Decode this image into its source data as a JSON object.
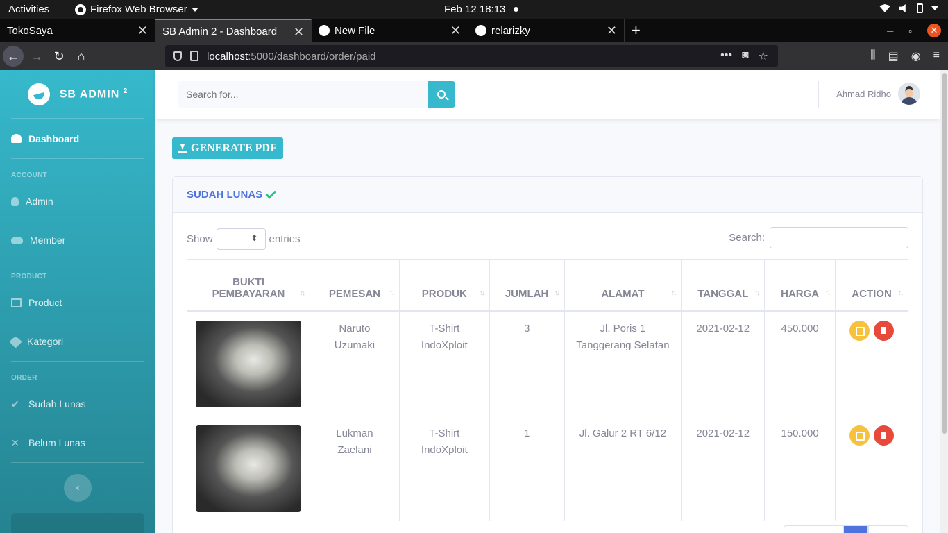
{
  "os": {
    "activities": "Activities",
    "app_name": "Firefox Web Browser",
    "clock": "Feb 12  18:13"
  },
  "browser": {
    "tabs": [
      {
        "title": "TokoSaya",
        "active": false
      },
      {
        "title": "SB Admin 2 - Dashboard",
        "active": true
      },
      {
        "title": "New File",
        "active": false
      },
      {
        "title": "relarizky",
        "active": false
      }
    ],
    "url_host": "localhost",
    "url_path": ":5000/dashboard/order/paid"
  },
  "sidebar": {
    "brand": "SB ADMIN",
    "brand_sup": "2",
    "dashboard": "Dashboard",
    "sections": [
      {
        "heading": "ACCOUNT",
        "items": [
          {
            "label": "Admin",
            "icon": "user-icon"
          },
          {
            "label": "Member",
            "icon": "users-icon"
          }
        ]
      },
      {
        "heading": "PRODUCT",
        "items": [
          {
            "label": "Product",
            "icon": "table-icon"
          },
          {
            "label": "Kategori",
            "icon": "tag-icon"
          }
        ]
      },
      {
        "heading": "ORDER",
        "items": [
          {
            "label": "Sudah Lunas",
            "icon": "check-icon"
          },
          {
            "label": "Belum Lunas",
            "icon": "times-icon"
          }
        ]
      }
    ]
  },
  "topbar": {
    "search_placeholder": "Search for...",
    "user_name": "Ahmad Ridho"
  },
  "content": {
    "generate_pdf": "GENERATE PDF",
    "card_title": "SUDAH LUNAS",
    "show_label": "Show",
    "entries_label": "entries",
    "search_label": "Search:",
    "columns": [
      "BUKTI PEMBAYARAN",
      "PEMESAN",
      "PRODUK",
      "JUMLAH",
      "ALAMAT",
      "TANGGAL",
      "HARGA",
      "ACTION"
    ],
    "rows": [
      {
        "pemesan": "Naruto Uzumaki",
        "produk": "T-Shirt IndoXploit",
        "jumlah": "3",
        "alamat": "Jl. Poris 1 Tanggerang Selatan",
        "tanggal": "2021-02-12",
        "harga": "450.000"
      },
      {
        "pemesan": "Lukman Zaelani",
        "produk": "T-Shirt IndoXploit",
        "jumlah": "1",
        "alamat": "Jl. Galur 2 RT 6/12",
        "tanggal": "2021-02-12",
        "harga": "150.000"
      }
    ]
  },
  "colors": {
    "primary": "#4e73df",
    "info": "#36b9cc",
    "warning": "#f6c23e",
    "danger": "#e74a3b",
    "success": "#1cc88a"
  }
}
